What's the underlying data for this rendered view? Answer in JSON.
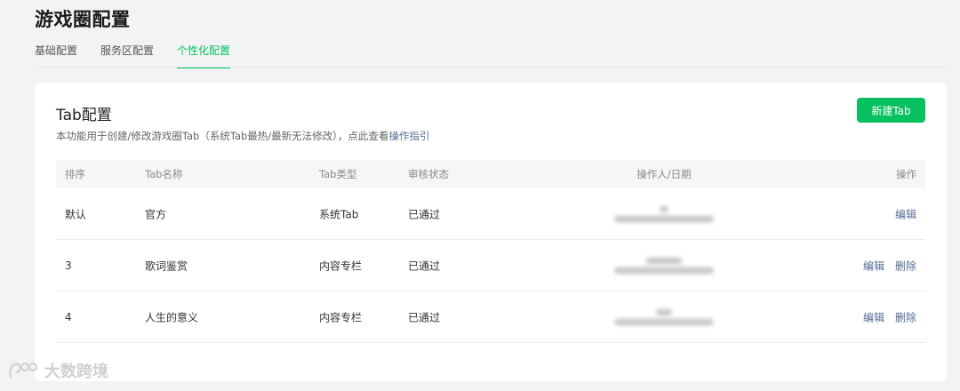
{
  "page": {
    "title": "游戏圈配置"
  },
  "tabs": [
    {
      "label": "基础配置",
      "active": false
    },
    {
      "label": "服务区配置",
      "active": false
    },
    {
      "label": "个性化配置",
      "active": true
    }
  ],
  "card": {
    "title": "Tab配置",
    "description": "本功能用于创建/修改游戏圈Tab（系统Tab最热/最新无法修改），点此查看",
    "guide_link": "操作指引",
    "new_button": "新建Tab"
  },
  "table": {
    "headers": {
      "order": "排序",
      "name": "Tab名称",
      "type": "Tab类型",
      "status": "审核状态",
      "operator": "操作人/日期",
      "actions": "操作"
    },
    "rows": [
      {
        "order": "默认",
        "name": "官方",
        "type": "系统Tab",
        "status": "已通过",
        "edit": "编辑",
        "delete": ""
      },
      {
        "order": "3",
        "name": "歌词鉴赏",
        "type": "内容专栏",
        "status": "已通过",
        "edit": "编辑",
        "delete": "删除"
      },
      {
        "order": "4",
        "name": "人生的意义",
        "type": "内容专栏",
        "status": "已通过",
        "edit": "编辑",
        "delete": "删除"
      }
    ]
  },
  "watermark": {
    "text": "大数跨境"
  },
  "colors": {
    "accent": "#07c160",
    "link": "#576b95",
    "page_bg": "#f2f3f5"
  }
}
